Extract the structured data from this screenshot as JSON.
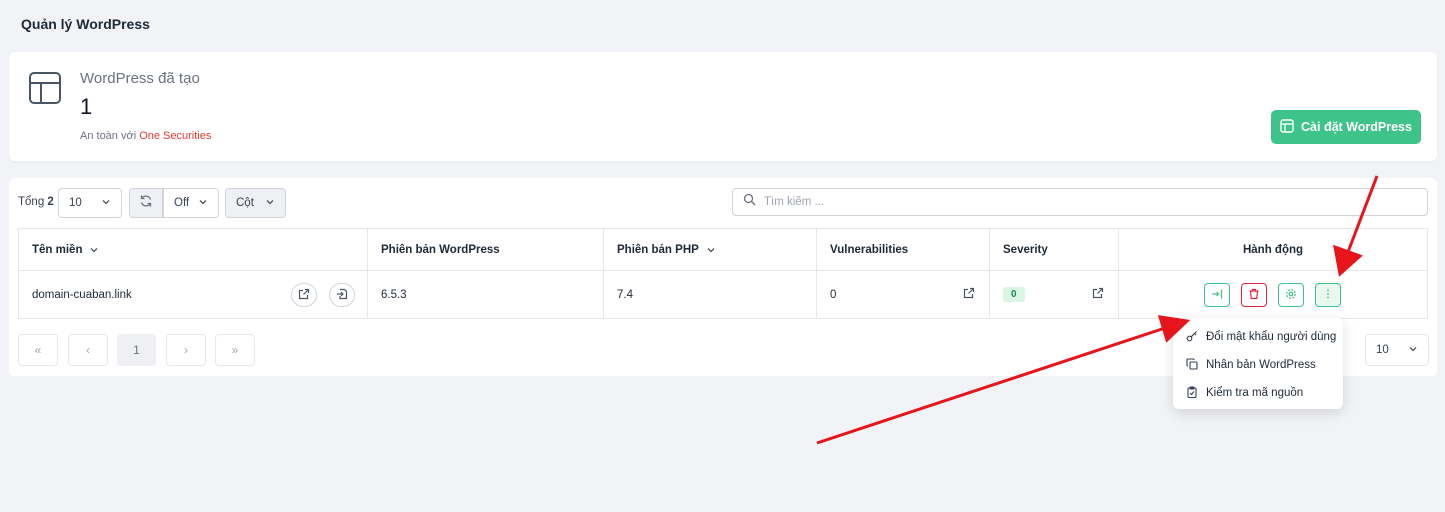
{
  "page": {
    "title": "Quản lý WordPress"
  },
  "stat": {
    "label": "WordPress đã tạo",
    "value": "1",
    "sub_prefix": "An toàn với",
    "sub_brand": "One Securities",
    "install_label": "Cài đặt WordPress"
  },
  "toolbar": {
    "total_label": "Tổng",
    "total_value": "2",
    "page_size": "10",
    "refresh_state": "Off",
    "columns_label": "Cột",
    "search_placeholder": "Tìm kiếm ..."
  },
  "table": {
    "headers": [
      "Tên miền",
      "Phiên bản WordPress",
      "Phiên bản PHP",
      "Vulnerabilities",
      "Severity",
      "Hành động"
    ],
    "rows": [
      {
        "domain": "domain-cuaban.link",
        "wp_version": "6.5.3",
        "php_version": "7.4",
        "vulnerabilities": "0",
        "severity": "0"
      }
    ]
  },
  "pagination": {
    "first": "«",
    "prev": "‹",
    "current": "1",
    "next": "›",
    "last": "»",
    "per_page": "10"
  },
  "dropdown_menu": {
    "items": [
      {
        "label": "Đổi mật khẩu người dùng",
        "icon": "key-icon"
      },
      {
        "label": "Nhân bản WordPress",
        "icon": "copy-icon"
      },
      {
        "label": "Kiểm tra mã nguồn",
        "icon": "clipboard-check-icon"
      }
    ]
  },
  "colors": {
    "accent_green": "#3ec38b",
    "danger_red": "#e0243d",
    "brand_red": "#e53935",
    "annotation_arrow": "#e8141c"
  }
}
